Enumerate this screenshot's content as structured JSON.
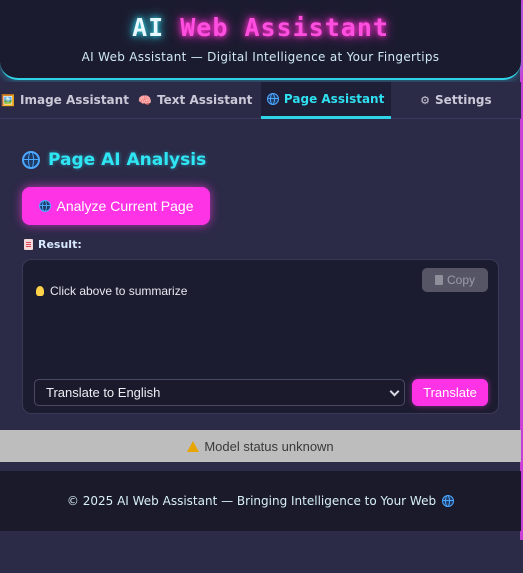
{
  "header": {
    "title_part1": "AI",
    "title_part2": "Web Assistant",
    "subtitle": "AI Web Assistant — Digital Intelligence at Your Fingertips"
  },
  "tabs": [
    {
      "label": "Image Assistant",
      "icon": "image-icon",
      "active": false
    },
    {
      "label": "Text Assistant",
      "icon": "brain-icon",
      "active": false
    },
    {
      "label": "Page Assistant",
      "icon": "globe-icon",
      "active": true
    },
    {
      "label": "Settings",
      "icon": "gear-icon",
      "active": false
    }
  ],
  "main": {
    "section_title": "Page AI Analysis",
    "analyze_button": "Analyze Current Page",
    "result_label": "Result:",
    "copy_button": "Copy",
    "result_text": "Click above to summarize",
    "language_select": "Translate to English",
    "translate_button": "Translate"
  },
  "status": {
    "text": "Model status unknown"
  },
  "footer": {
    "text": "© 2025 AI Web Assistant — Bringing Intelligence to Your Web"
  },
  "colors": {
    "accent_cyan": "#2fd4e8",
    "accent_pink": "#ff33e6",
    "background": "#2b2a47",
    "panel": "#1c1c30"
  }
}
